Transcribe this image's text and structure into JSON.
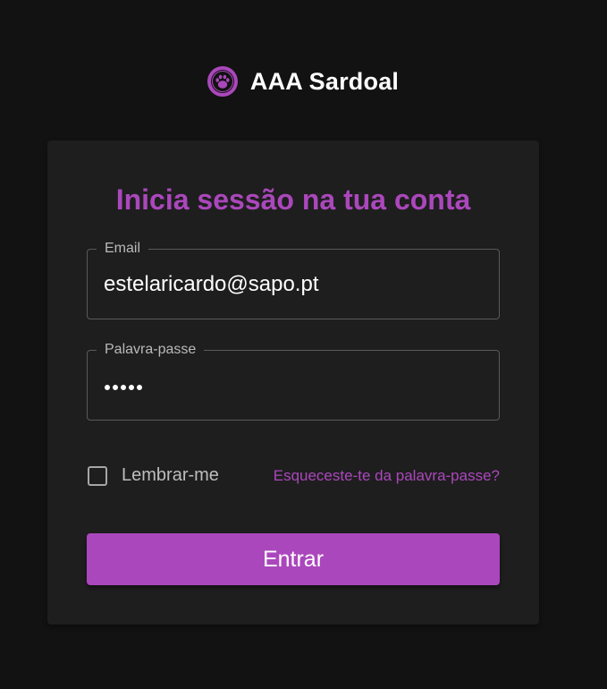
{
  "brand": {
    "name": "AAA Sardoal",
    "logo_icon": "paw-icon",
    "accent_color": "#ab47bc"
  },
  "login": {
    "title": "Inicia sessão na tua conta",
    "email": {
      "label": "Email",
      "value": "estelaricardo@sapo.pt"
    },
    "password": {
      "label": "Palavra-passe",
      "masked_length": 5
    },
    "remember_me": {
      "label": "Lembrar-me",
      "checked": false
    },
    "forgot_password_label": "Esqueceste-te da palavra-passe?",
    "submit_label": "Entrar"
  }
}
